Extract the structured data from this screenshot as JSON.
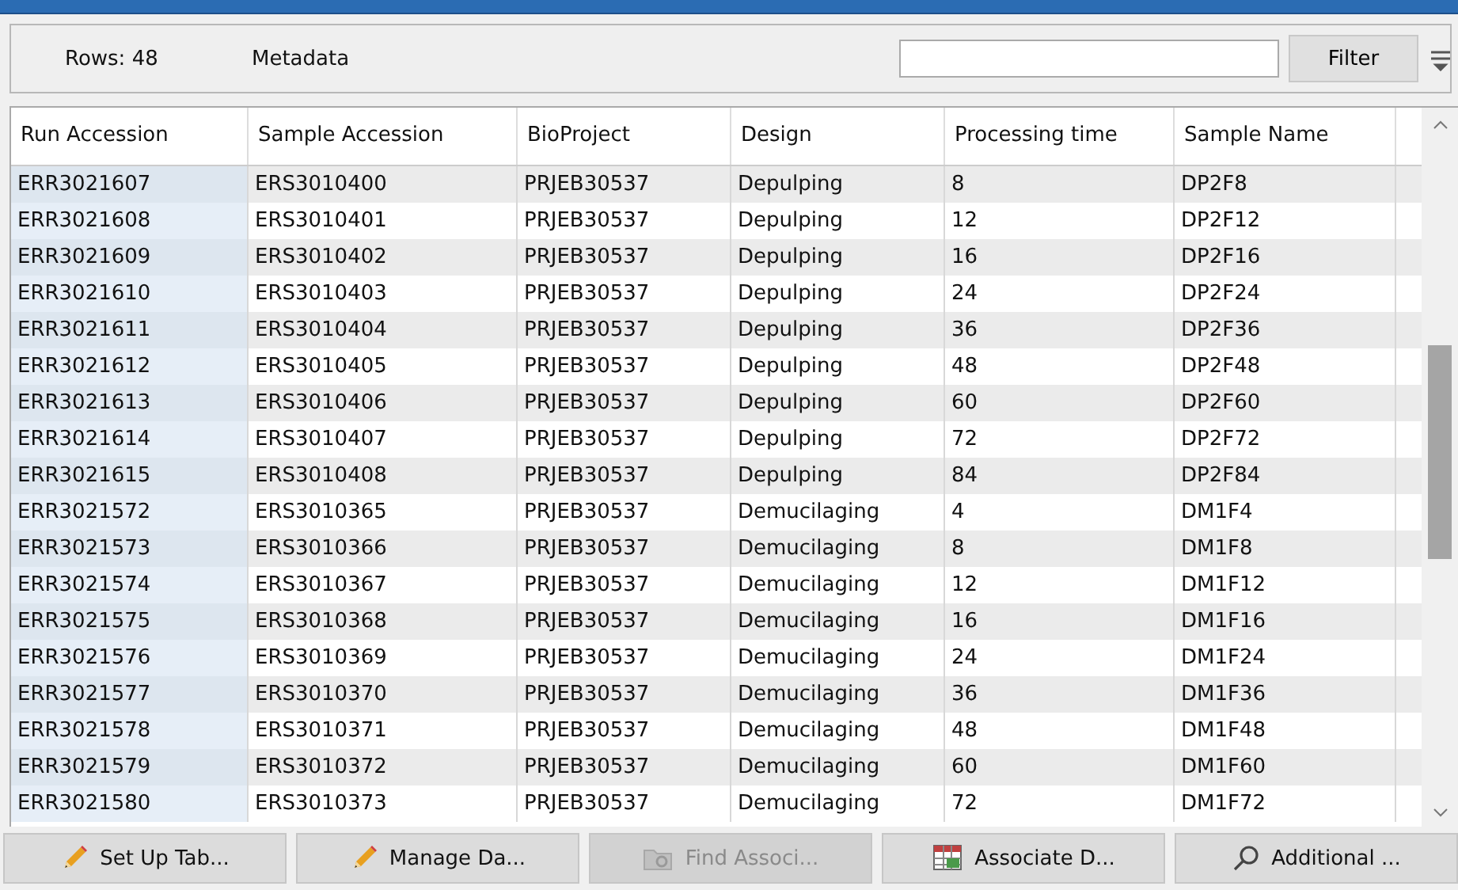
{
  "toolbar": {
    "row_count": "Rows: 48",
    "label": "Metadata",
    "filter_button": "Filter"
  },
  "table": {
    "columns": [
      "Run Accession",
      "Sample Accession",
      "BioProject",
      "Design",
      "Processing time",
      "Sample Name"
    ],
    "rows": [
      [
        "ERR3021607",
        "ERS3010400",
        "PRJEB30537",
        "Depulping",
        "8",
        "DP2F8"
      ],
      [
        "ERR3021608",
        "ERS3010401",
        "PRJEB30537",
        "Depulping",
        "12",
        "DP2F12"
      ],
      [
        "ERR3021609",
        "ERS3010402",
        "PRJEB30537",
        "Depulping",
        "16",
        "DP2F16"
      ],
      [
        "ERR3021610",
        "ERS3010403",
        "PRJEB30537",
        "Depulping",
        "24",
        "DP2F24"
      ],
      [
        "ERR3021611",
        "ERS3010404",
        "PRJEB30537",
        "Depulping",
        "36",
        "DP2F36"
      ],
      [
        "ERR3021612",
        "ERS3010405",
        "PRJEB30537",
        "Depulping",
        "48",
        "DP2F48"
      ],
      [
        "ERR3021613",
        "ERS3010406",
        "PRJEB30537",
        "Depulping",
        "60",
        "DP2F60"
      ],
      [
        "ERR3021614",
        "ERS3010407",
        "PRJEB30537",
        "Depulping",
        "72",
        "DP2F72"
      ],
      [
        "ERR3021615",
        "ERS3010408",
        "PRJEB30537",
        "Depulping",
        "84",
        "DP2F84"
      ],
      [
        "ERR3021572",
        "ERS3010365",
        "PRJEB30537",
        "Demucilaging",
        "4",
        "DM1F4"
      ],
      [
        "ERR3021573",
        "ERS3010366",
        "PRJEB30537",
        "Demucilaging",
        "8",
        "DM1F8"
      ],
      [
        "ERR3021574",
        "ERS3010367",
        "PRJEB30537",
        "Demucilaging",
        "12",
        "DM1F12"
      ],
      [
        "ERR3021575",
        "ERS3010368",
        "PRJEB30537",
        "Demucilaging",
        "16",
        "DM1F16"
      ],
      [
        "ERR3021576",
        "ERS3010369",
        "PRJEB30537",
        "Demucilaging",
        "24",
        "DM1F24"
      ],
      [
        "ERR3021577",
        "ERS3010370",
        "PRJEB30537",
        "Demucilaging",
        "36",
        "DM1F36"
      ],
      [
        "ERR3021578",
        "ERS3010371",
        "PRJEB30537",
        "Demucilaging",
        "48",
        "DM1F48"
      ],
      [
        "ERR3021579",
        "ERS3010372",
        "PRJEB30537",
        "Demucilaging",
        "60",
        "DM1F60"
      ],
      [
        "ERR3021580",
        "ERS3010373",
        "PRJEB30537",
        "Demucilaging",
        "72",
        "DM1F72"
      ]
    ]
  },
  "buttons": [
    {
      "label": "Set Up Tab...",
      "kind": "pencil",
      "disabled": false
    },
    {
      "label": "Manage Da...",
      "kind": "pencil",
      "disabled": false
    },
    {
      "label": "Find Associ...",
      "kind": "folder",
      "disabled": true
    },
    {
      "label": "Associate D...",
      "kind": "table",
      "disabled": false
    },
    {
      "label": "Additional ...",
      "kind": "search",
      "disabled": false
    }
  ]
}
